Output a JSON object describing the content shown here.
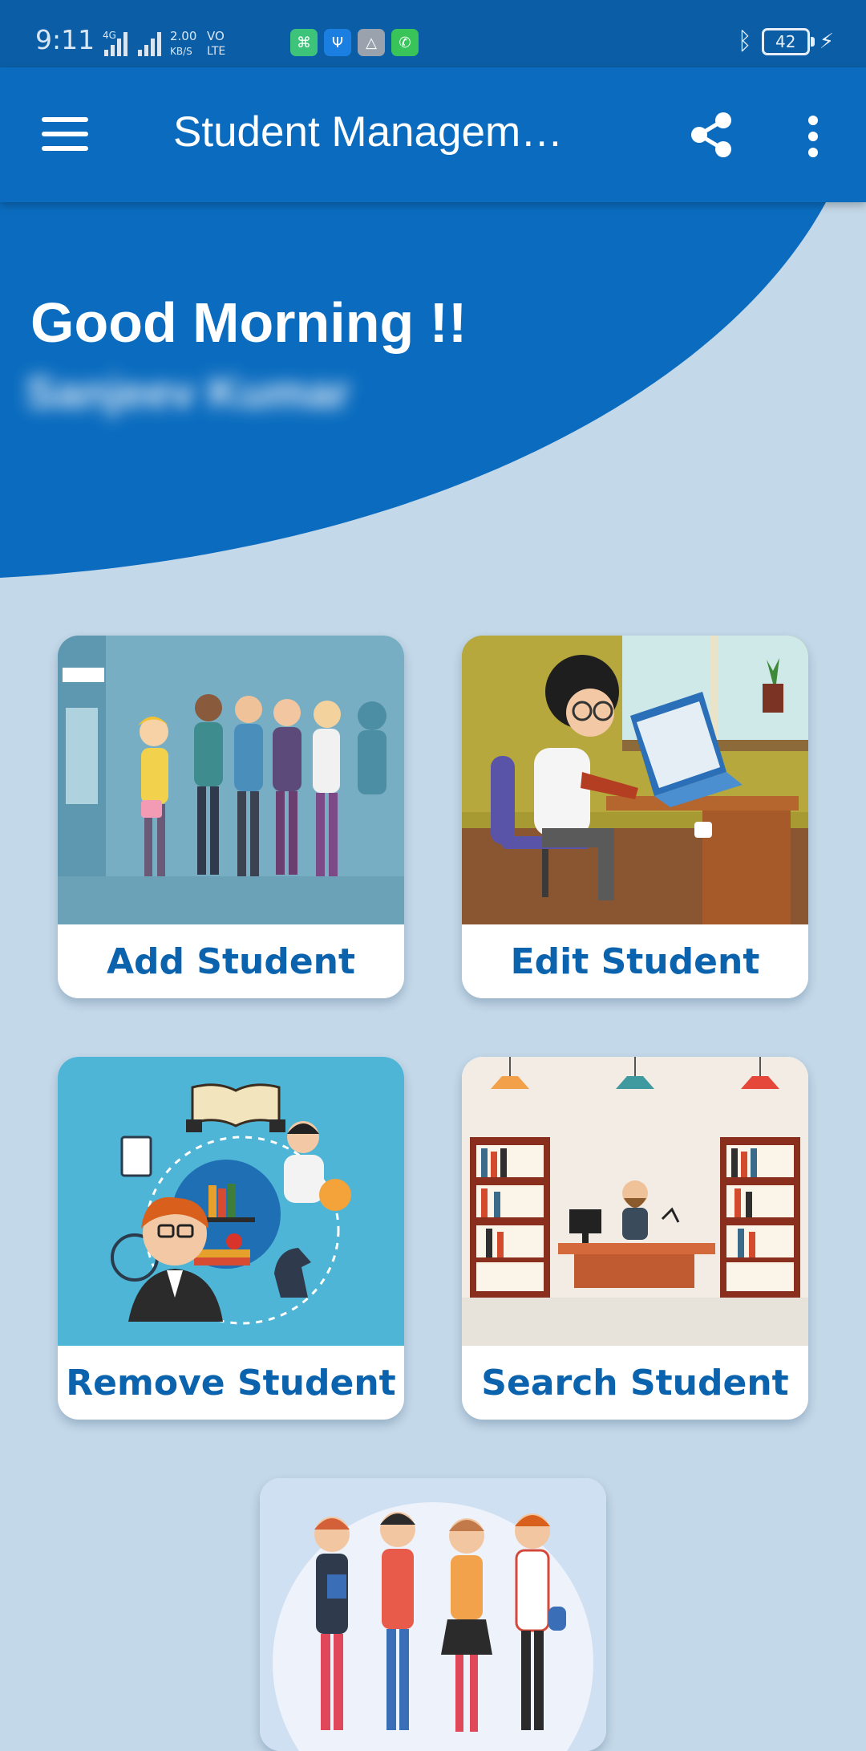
{
  "status_bar": {
    "time": "9:11",
    "network": "4G",
    "speed_value": "2.00",
    "speed_unit": "KB/S",
    "volte_top": "VO",
    "volte_bottom": "LTE",
    "battery_level": "42"
  },
  "app_bar": {
    "title": "Student Managem…",
    "menu_icon": "hamburger-menu-icon",
    "share_icon": "share-icon",
    "more_icon": "more-vert-icon"
  },
  "header": {
    "greeting": "Good Morning !!",
    "user_name": "Sanjeev Kumar"
  },
  "cards": {
    "add": {
      "label": "Add Student"
    },
    "edit": {
      "label": "Edit Student"
    },
    "remove": {
      "label": "Remove Student"
    },
    "search": {
      "label": "Search Student"
    }
  },
  "colors": {
    "primary": "#0b6cbf",
    "status_bar": "#0b5ea6",
    "background": "#c3d8e8",
    "card_label": "#0b63ae"
  }
}
